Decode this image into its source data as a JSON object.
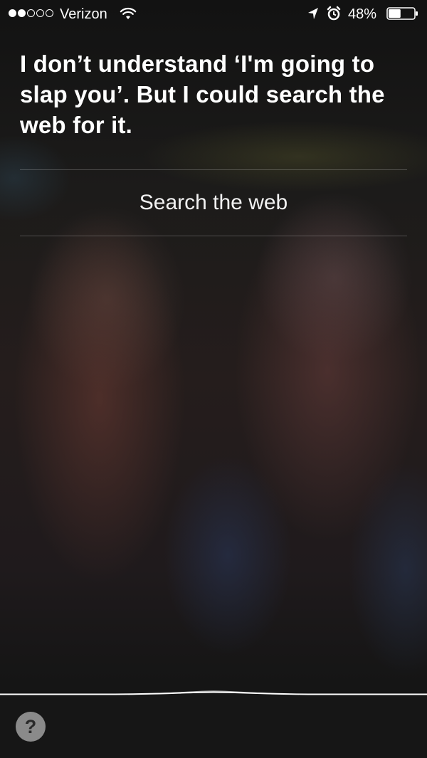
{
  "status_bar": {
    "signal_dots_filled": 2,
    "signal_dots_total": 5,
    "carrier": "Verizon",
    "wifi_icon": "wifi-icon",
    "location_icon": "location-arrow-icon",
    "alarm_icon": "alarm-clock-icon",
    "battery_percent": "48%",
    "battery_level": 0.48
  },
  "siri": {
    "response_text": "I don’t understand ‘I'm going to slap you’. But I could search the web for it.",
    "search_button_label": "Search the web"
  },
  "bottom": {
    "help_label": "?",
    "help_icon": "question-mark-icon",
    "waveform_icon": "siri-waveform-icon"
  },
  "colors": {
    "background": "#161616",
    "text": "#ffffff",
    "help_button": "#8a8a8a"
  }
}
